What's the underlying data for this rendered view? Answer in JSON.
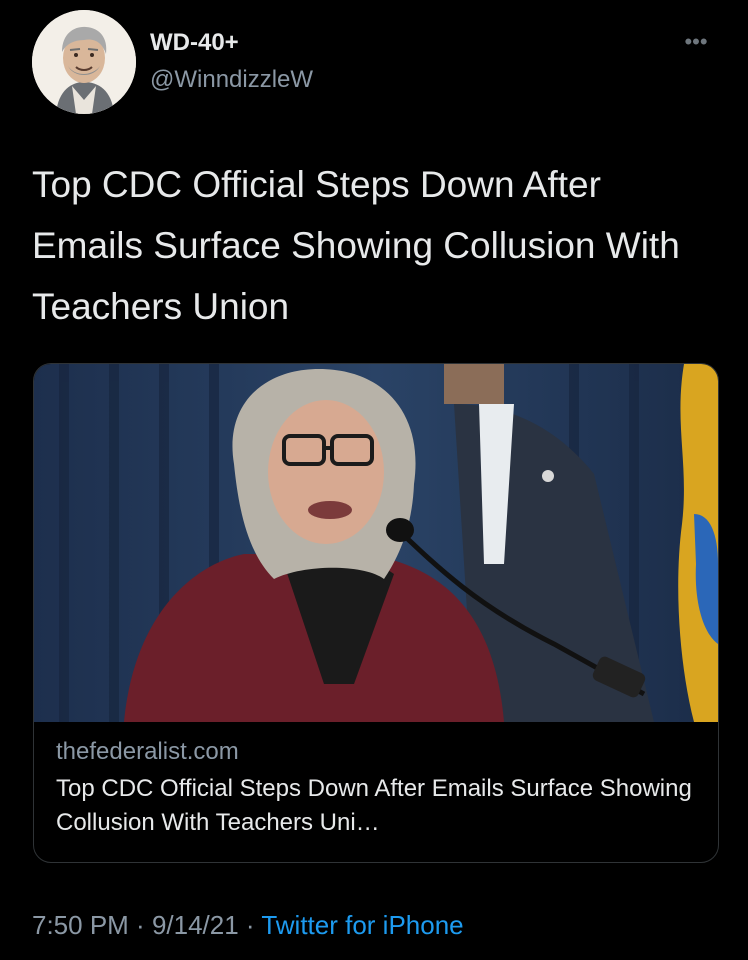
{
  "tweet": {
    "display_name": "WD-40+",
    "handle": "@WinndizzleW",
    "more_icon": "more-icon",
    "text": "Top CDC Official Steps Down After Emails Surface Showing Collusion With Teachers Union"
  },
  "card": {
    "domain": "thefederalist.com",
    "title": "Top CDC Official Steps Down After Emails Surface Showing Collusion With Teachers Uni…"
  },
  "meta": {
    "time": "7:50 PM",
    "separator": " · ",
    "date": "9/14/21",
    "source": "Twitter for iPhone"
  },
  "colors": {
    "background": "#000000",
    "text": "#e7e9ea",
    "secondary": "#8b98a5",
    "link": "#1d9bf0"
  }
}
